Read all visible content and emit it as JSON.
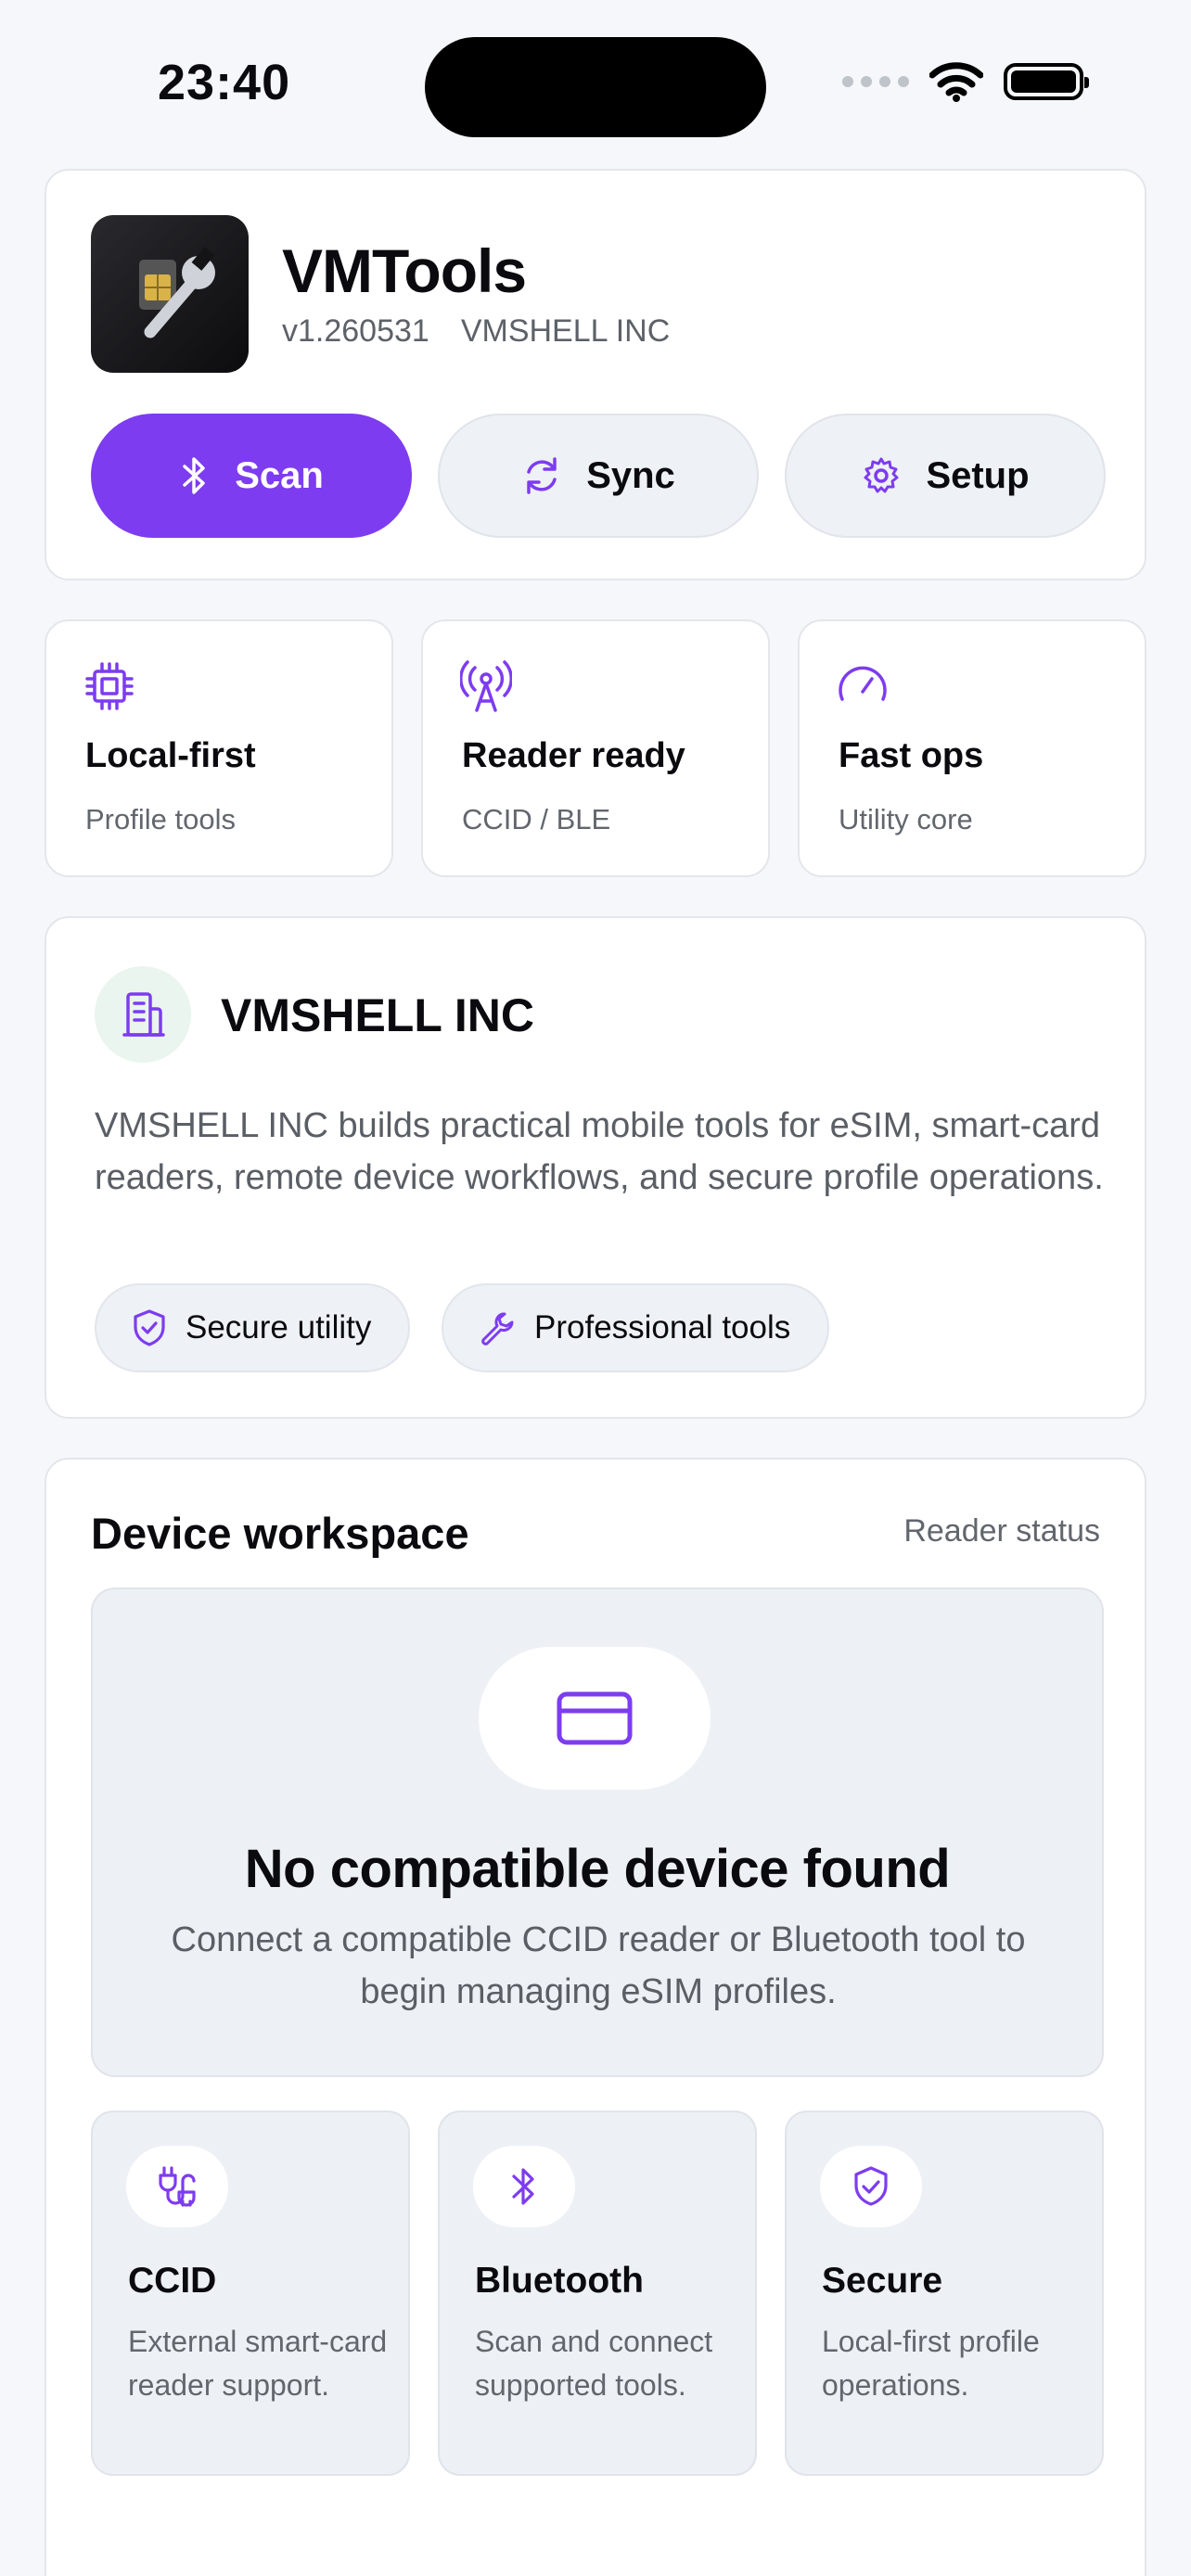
{
  "status_bar": {
    "time": "23:40"
  },
  "app": {
    "name": "VMTools",
    "version": "v1.260531",
    "publisher": "VMSHELL INC"
  },
  "actions": {
    "scan": "Scan",
    "sync": "Sync",
    "setup": "Setup"
  },
  "features": [
    {
      "title": "Local-first",
      "subtitle": "Profile tools",
      "icon": "chip-icon"
    },
    {
      "title": "Reader ready",
      "subtitle": "CCID / BLE",
      "icon": "antenna-icon"
    },
    {
      "title": "Fast ops",
      "subtitle": "Utility core",
      "icon": "gauge-icon"
    }
  ],
  "company": {
    "name": "VMSHELL INC",
    "description": "VMSHELL INC builds practical mobile tools for eSIM, smart-card readers, remote device workflows, and secure profile operations.",
    "tags": [
      "Secure utility",
      "Professional tools"
    ]
  },
  "workspace": {
    "title": "Device workspace",
    "status_label": "Reader status",
    "empty_title": "No compatible device found",
    "empty_description": "Connect a compatible CCID reader or Bluetooth tool to begin managing eSIM profiles.",
    "options": [
      {
        "title": "CCID",
        "description": "External smart-card reader support."
      },
      {
        "title": "Bluetooth",
        "description": "Scan and connect supported tools."
      },
      {
        "title": "Secure",
        "description": "Local-first profile operations."
      }
    ]
  },
  "colors": {
    "accent": "#7d3cf0",
    "background": "#f6f7fa",
    "panel": "#edf1f5"
  }
}
